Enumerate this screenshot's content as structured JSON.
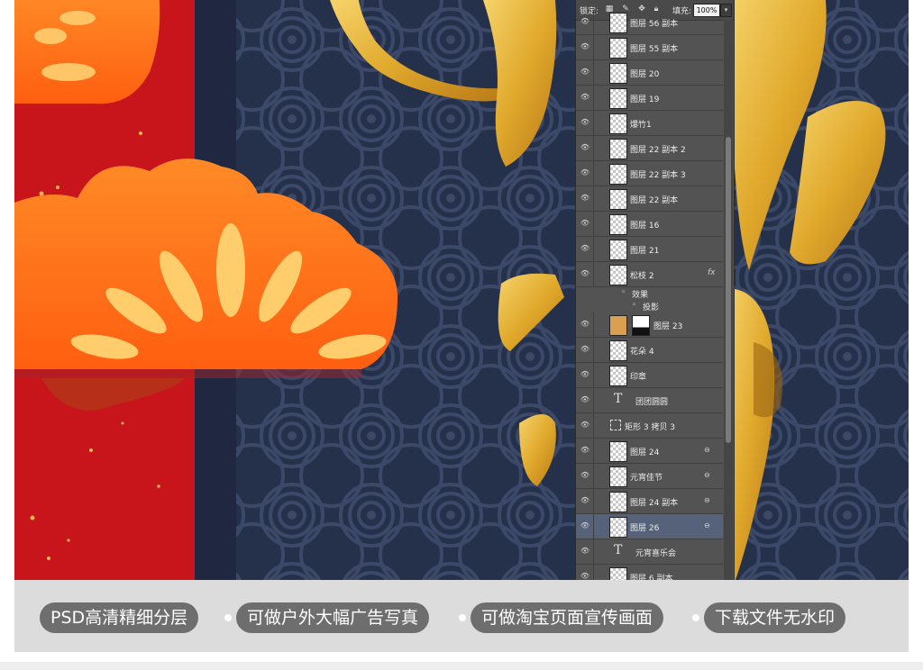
{
  "panel": {
    "lock_label": "锁定:",
    "fill_label": "填充:",
    "fill_value": "100%",
    "layers": [
      {
        "name": "图层 56 副本",
        "kind": "pixel"
      },
      {
        "name": "图层 55 副本",
        "kind": "pixel"
      },
      {
        "name": "图层 20",
        "kind": "pixel"
      },
      {
        "name": "图层 19",
        "kind": "pixel"
      },
      {
        "name": "爆竹1",
        "kind": "pixel"
      },
      {
        "name": "图层 22 副本 2",
        "kind": "pixel"
      },
      {
        "name": "图层 22 副本 3",
        "kind": "pixel"
      },
      {
        "name": "图层 22 副本",
        "kind": "pixel"
      },
      {
        "name": "图层 16",
        "kind": "pixel"
      },
      {
        "name": "图层 21",
        "kind": "pixel"
      },
      {
        "name": "松枝 2",
        "kind": "pixel",
        "fx": "fx"
      },
      {
        "name": "图层 23",
        "kind": "masked"
      },
      {
        "name": "花朵 4",
        "kind": "pixel"
      },
      {
        "name": "印章",
        "kind": "pixel"
      },
      {
        "name": "团团圆圆",
        "kind": "text"
      },
      {
        "name": "矩形 3 拷贝 3",
        "kind": "shape"
      },
      {
        "name": "图层 24",
        "kind": "linked"
      },
      {
        "name": "元宵佳节",
        "kind": "linked"
      },
      {
        "name": "图层 24 副本",
        "kind": "linked"
      },
      {
        "name": "图层 26",
        "kind": "linked",
        "selected": true
      },
      {
        "name": "元宵喜乐会",
        "kind": "text"
      },
      {
        "name": "图层 6 副本",
        "kind": "pixel"
      }
    ],
    "effects_label": "效果",
    "shadow_label": "投影"
  },
  "footer": {
    "tags": [
      "PSD高清精细分层",
      "可做户外大幅广告写真",
      "可做淘宝页面宣传画面",
      "下载文件无水印"
    ]
  },
  "colors": {
    "navy": "#25304a",
    "red": "#c8151c",
    "orange": "#ff7a1c",
    "gold": "#e2ad2f",
    "tag": "#6e6e6e"
  }
}
